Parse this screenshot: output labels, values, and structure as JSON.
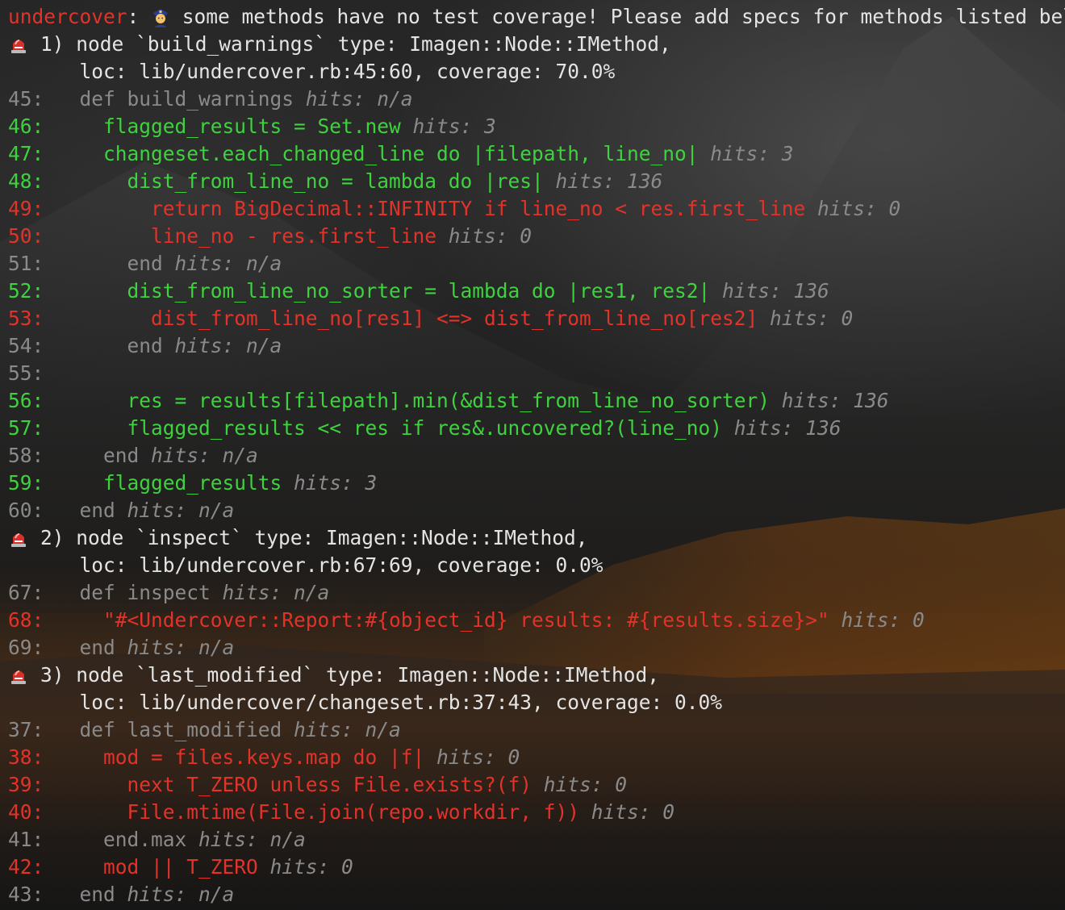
{
  "header": {
    "tool": "undercover",
    "message": " some methods have no test coverage! Please add specs for methods listed below",
    "icon": "police-officer-icon"
  },
  "colors": {
    "covered": "#3fd23f",
    "uncovered": "#e2332a",
    "neutral": "#8a8a8a",
    "text": "#e4e4e4"
  },
  "items": [
    {
      "icon": "rotating-light-icon",
      "title": "1) node `build_warnings` type: Imagen::Node::IMethod,",
      "loc": "loc: lib/undercover.rb:45:60, coverage: 70.0%",
      "lines": [
        {
          "no": "45:",
          "indent": "   ",
          "code": "def build_warnings",
          "hits": "hits: n/a",
          "status": "d"
        },
        {
          "no": "46:",
          "indent": "     ",
          "code": "flagged_results = Set.new",
          "hits": "hits: 3",
          "status": "g"
        },
        {
          "no": "47:",
          "indent": "     ",
          "code": "changeset.each_changed_line do |filepath, line_no|",
          "hits": "hits: 3",
          "status": "g"
        },
        {
          "no": "48:",
          "indent": "       ",
          "code": "dist_from_line_no = lambda do |res|",
          "hits": "hits: 136",
          "status": "g"
        },
        {
          "no": "49:",
          "indent": "         ",
          "code": "return BigDecimal::INFINITY if line_no < res.first_line",
          "hits": "hits: 0",
          "status": "r"
        },
        {
          "no": "50:",
          "indent": "         ",
          "code": "line_no - res.first_line",
          "hits": "hits: 0",
          "status": "r"
        },
        {
          "no": "51:",
          "indent": "       ",
          "code": "end",
          "hits": "hits: n/a",
          "status": "d"
        },
        {
          "no": "52:",
          "indent": "       ",
          "code": "dist_from_line_no_sorter = lambda do |res1, res2|",
          "hits": "hits: 136",
          "status": "g"
        },
        {
          "no": "53:",
          "indent": "         ",
          "code": "dist_from_line_no[res1] <=> dist_from_line_no[res2]",
          "hits": "hits: 0",
          "status": "r"
        },
        {
          "no": "54:",
          "indent": "       ",
          "code": "end",
          "hits": "hits: n/a",
          "status": "d"
        },
        {
          "no": "55:",
          "indent": "",
          "code": "",
          "hits": "",
          "status": "d"
        },
        {
          "no": "56:",
          "indent": "       ",
          "code": "res = results[filepath].min(&dist_from_line_no_sorter)",
          "hits": "hits: 136",
          "status": "g"
        },
        {
          "no": "57:",
          "indent": "       ",
          "code": "flagged_results << res if res&.uncovered?(line_no)",
          "hits": "hits: 136",
          "status": "g"
        },
        {
          "no": "58:",
          "indent": "     ",
          "code": "end",
          "hits": "hits: n/a",
          "status": "d"
        },
        {
          "no": "59:",
          "indent": "     ",
          "code": "flagged_results",
          "hits": "hits: 3",
          "status": "g"
        },
        {
          "no": "60:",
          "indent": "   ",
          "code": "end",
          "hits": "hits: n/a",
          "status": "d"
        }
      ]
    },
    {
      "icon": "rotating-light-icon",
      "title": "2) node `inspect` type: Imagen::Node::IMethod,",
      "loc": "loc: lib/undercover.rb:67:69, coverage: 0.0%",
      "lines": [
        {
          "no": "67:",
          "indent": "   ",
          "code": "def inspect",
          "hits": "hits: n/a",
          "status": "d"
        },
        {
          "no": "68:",
          "indent": "     ",
          "code": "\"#<Undercover::Report:#{object_id} results: #{results.size}>\"",
          "hits": "hits: 0",
          "status": "r"
        },
        {
          "no": "69:",
          "indent": "   ",
          "code": "end",
          "hits": "hits: n/a",
          "status": "d"
        }
      ]
    },
    {
      "icon": "rotating-light-icon",
      "title": "3) node `last_modified` type: Imagen::Node::IMethod,",
      "loc": "loc: lib/undercover/changeset.rb:37:43, coverage: 0.0%",
      "lines": [
        {
          "no": "37:",
          "indent": "   ",
          "code": "def last_modified",
          "hits": "hits: n/a",
          "status": "d"
        },
        {
          "no": "38:",
          "indent": "     ",
          "code": "mod = files.keys.map do |f|",
          "hits": "hits: 0",
          "status": "r"
        },
        {
          "no": "39:",
          "indent": "       ",
          "code": "next T_ZERO unless File.exists?(f)",
          "hits": "hits: 0",
          "status": "r"
        },
        {
          "no": "40:",
          "indent": "       ",
          "code": "File.mtime(File.join(repo.workdir, f))",
          "hits": "hits: 0",
          "status": "r"
        },
        {
          "no": "41:",
          "indent": "     ",
          "code": "end.max",
          "hits": "hits: n/a",
          "status": "d"
        },
        {
          "no": "42:",
          "indent": "     ",
          "code": "mod || T_ZERO",
          "hits": "hits: 0",
          "status": "r"
        },
        {
          "no": "43:",
          "indent": "   ",
          "code": "end",
          "hits": "hits: n/a",
          "status": "d"
        }
      ]
    }
  ]
}
